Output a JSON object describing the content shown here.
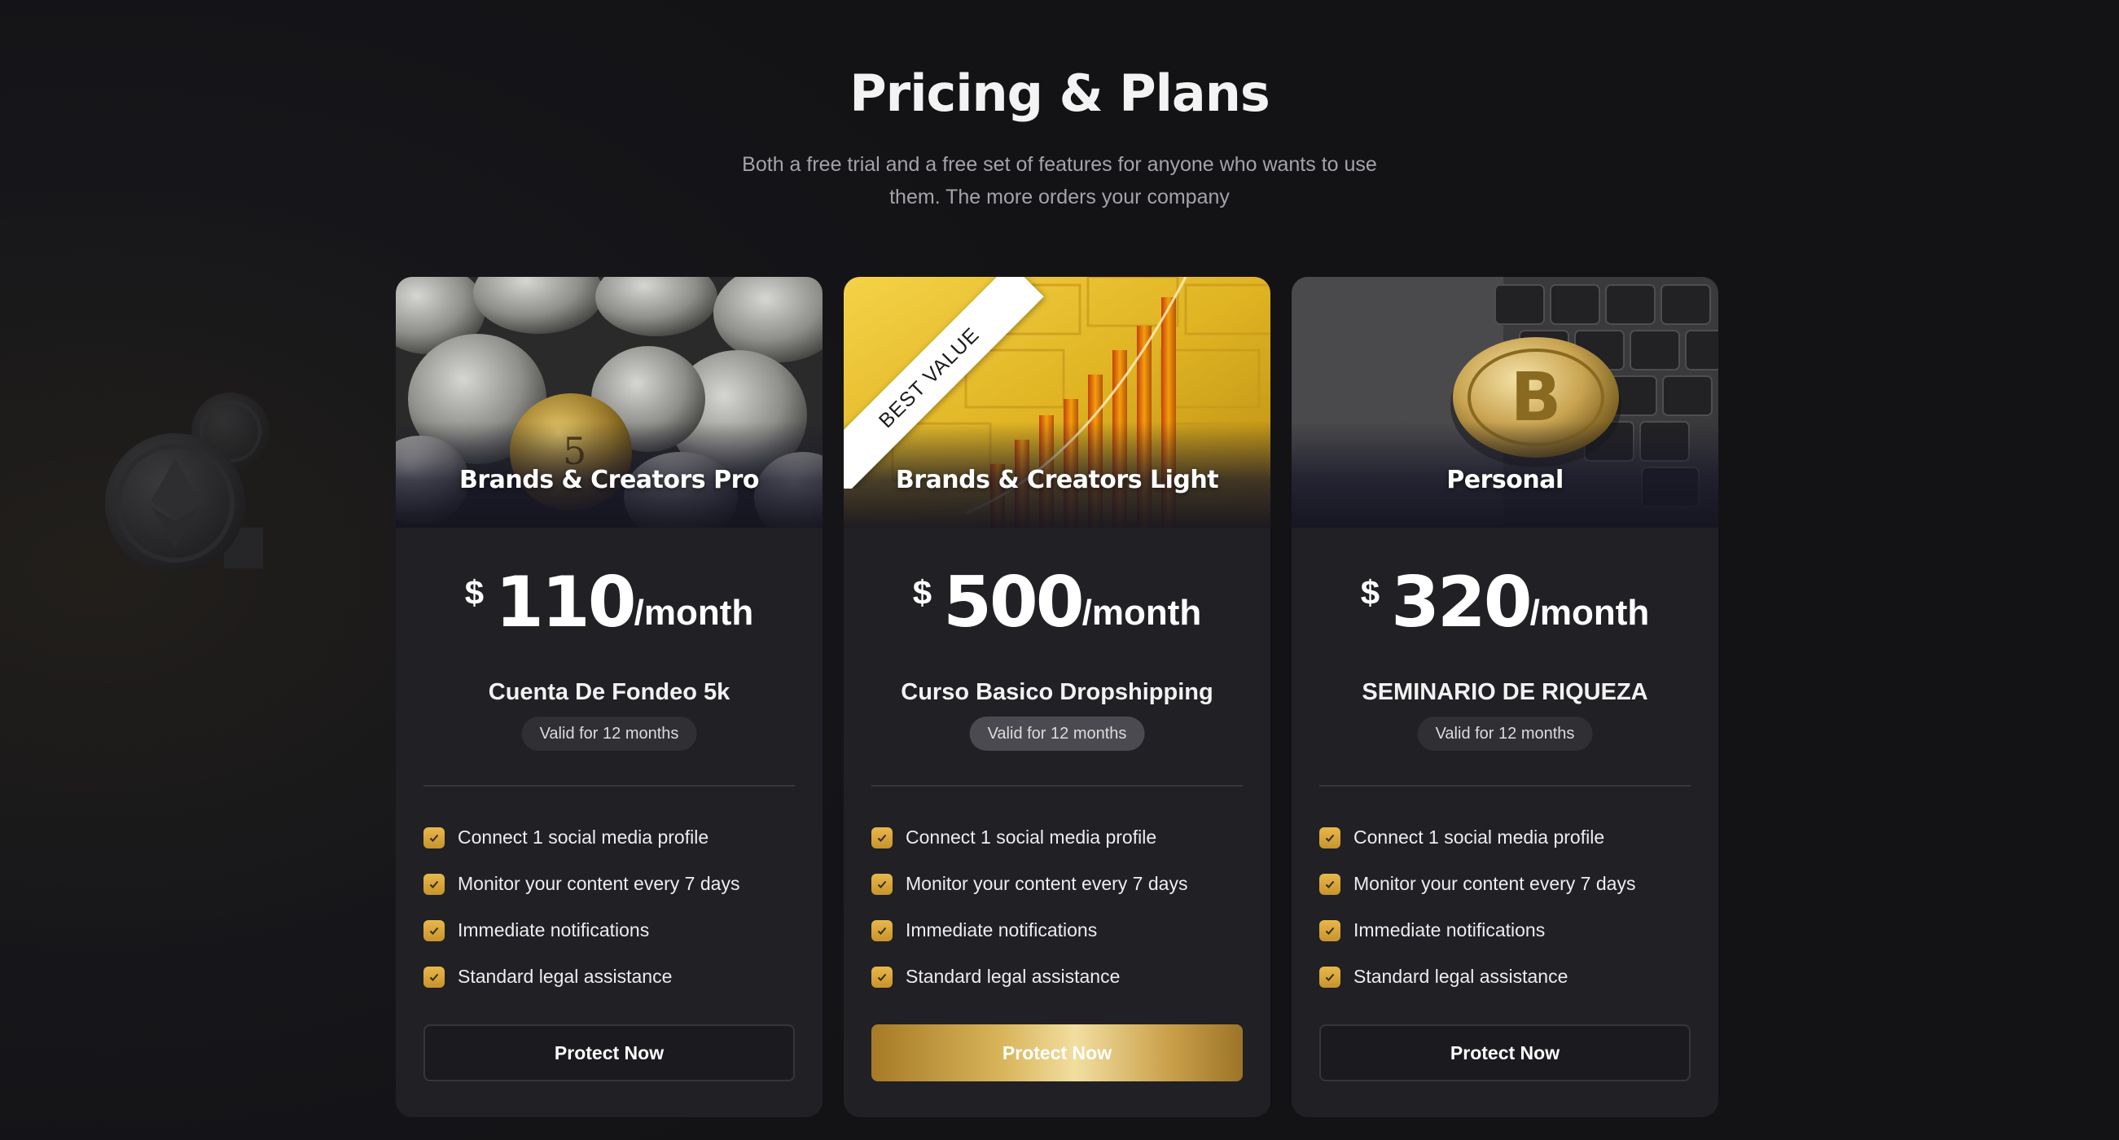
{
  "header": {
    "title": "Pricing & Plans",
    "subtitle_line1": "Both a free trial and a free set of features for anyone who wants to use",
    "subtitle_line2": "them. The more orders your company"
  },
  "colors": {
    "background": "#16161a",
    "card": "#202025",
    "accent_gold": "#d4a84a",
    "text_muted": "#a3a3aa"
  },
  "plans": [
    {
      "name": "Brands & Creators Pro",
      "image_icon": "silver-coins-image",
      "currency": "$",
      "amount": "110",
      "period": "/month",
      "course": "Cuenta De Fondeo 5k",
      "validity": "Valid for 12 months",
      "features": [
        "Connect 1 social media profile",
        "Monitor your content every 7 days",
        "Immediate notifications",
        "Standard legal assistance"
      ],
      "cta": "Protect Now"
    },
    {
      "name": "Brands & Creators Light",
      "badge": "BEST VALUE",
      "image_icon": "gold-bars-chart-image",
      "currency": "$",
      "amount": "500",
      "period": "/month",
      "course": "Curso Basico Dropshipping",
      "validity": "Valid for 12 months",
      "features": [
        "Connect 1 social media profile",
        "Monitor your content every 7 days",
        "Immediate notifications",
        "Standard legal assistance"
      ],
      "cta": "Protect Now"
    },
    {
      "name": "Personal",
      "image_icon": "bitcoin-on-keyboard-image",
      "currency": "$",
      "amount": "320",
      "period": "/month",
      "course": "SEMINARIO DE RIQUEZA",
      "validity": "Valid for 12 months",
      "features": [
        "Connect 1 social media profile",
        "Monitor your content every 7 days",
        "Immediate notifications",
        "Standard legal assistance"
      ],
      "cta": "Protect Now"
    }
  ]
}
